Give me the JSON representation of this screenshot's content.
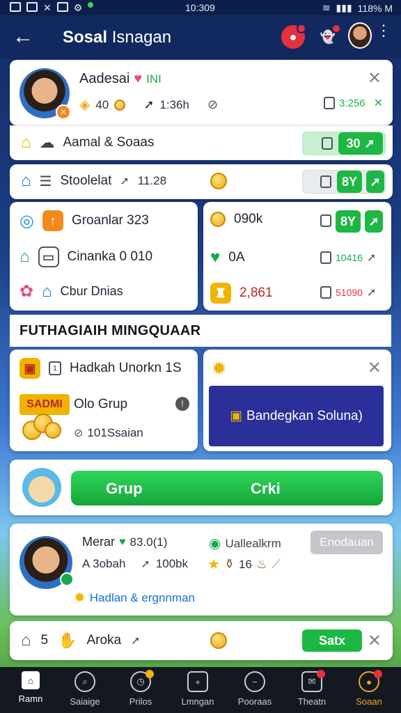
{
  "status_bar": {
    "time": "10:309",
    "battery": "118% M"
  },
  "header": {
    "title_bold": "Sosal",
    "title_rest": "Isnagan"
  },
  "profile": {
    "name": "Aadesai",
    "tag": "INI",
    "coins": "40",
    "time": "1:36h",
    "count": "3:256"
  },
  "row_social": {
    "label": "Aamal & Soaas",
    "button": "30"
  },
  "row_status": {
    "label": "Stoolelat",
    "extra": "11.28",
    "button": "8Y"
  },
  "left_list": [
    {
      "label": "Groanlar 323"
    },
    {
      "label": "Cinanka 0 010"
    },
    {
      "label": "Cbur Dnias"
    }
  ],
  "right_list": [
    {
      "value": "090k",
      "action": "8Y"
    },
    {
      "value": "0A",
      "count": "10416"
    },
    {
      "value": "2,861",
      "count": "51090"
    }
  ],
  "section_title": "FUTHAGIAIH MINGQUAAR",
  "left_card": {
    "title": "Hadkah Unorkn 1S",
    "badge": "SADMI",
    "group": "Olo Grup",
    "count": "101Ssaian"
  },
  "right_card": {
    "button": "Bandegkan Soluna)"
  },
  "cta": {
    "left": "Grup",
    "right": "Crki"
  },
  "member": {
    "name": "Merar",
    "score": "83.0(1)",
    "handle": "Uallealkrm",
    "sub": "A 3obah",
    "sub_count": "100bk",
    "level": "16",
    "link": "Hadlan & ergnnman",
    "button": "Enodauan"
  },
  "bottom_row": {
    "num": "5",
    "label": "Aroka",
    "button": "Satx"
  },
  "nav": [
    {
      "label": "Ramn"
    },
    {
      "label": "Saiaige"
    },
    {
      "label": "Prilos"
    },
    {
      "label": "Lmngan"
    },
    {
      "label": "Pooraas"
    },
    {
      "label": "Theatn"
    },
    {
      "label": "Soaan"
    }
  ],
  "colors": {
    "accent_green": "#1db843",
    "header_blue": "#12295f",
    "purple": "#2a2f9a"
  }
}
